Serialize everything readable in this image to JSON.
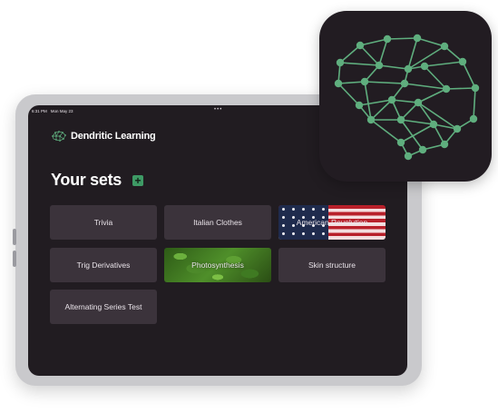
{
  "status_bar": {
    "time": "6:31 PM",
    "date": "Mon May 23",
    "dots": "•••"
  },
  "brand": {
    "name": "Dendritic Learning",
    "icon": "brain-icon"
  },
  "sets": {
    "title": "Your sets",
    "add_label": "+",
    "cards": [
      {
        "label": "Trivia",
        "image": "none"
      },
      {
        "label": "Italian Clothes",
        "image": "none"
      },
      {
        "label": "American Revolution",
        "image": "american-flag"
      },
      {
        "label": "Trig Derivatives",
        "image": "none"
      },
      {
        "label": "Photosynthesis",
        "image": "green-leaves"
      },
      {
        "label": "Skin structure",
        "image": "none"
      },
      {
        "label": "Alternating Series Test",
        "image": "none"
      }
    ]
  },
  "colors": {
    "background": "#211c21",
    "card": "#3b333b",
    "accent": "#3e9a65",
    "node": "#5fae7e"
  }
}
